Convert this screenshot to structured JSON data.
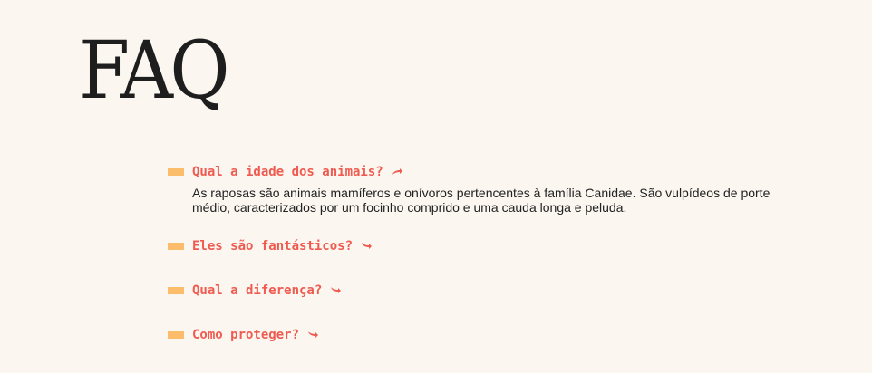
{
  "title": "FAQ",
  "colors": {
    "background": "#fbf6ef",
    "accent": "#ef5b50",
    "marker": "#fcbd6a",
    "text": "#222222"
  },
  "faq": {
    "items": [
      {
        "question": "Qual a idade dos animais?",
        "expanded": true,
        "arrow_icon": "arrow-up-curved-icon",
        "arrow_glyph": "☝",
        "answer": "As raposas são animais mamíferos e onívoros pertencentes à família Canidae. São vulpídeos de porte médio, caracterizados por um focinho comprido e uma cauda longa e peluda."
      },
      {
        "question": "Eles são fantásticos?",
        "expanded": false,
        "arrow_icon": "arrow-down-curved-icon",
        "arrow_glyph": "☟"
      },
      {
        "question": "Qual a diferença?",
        "expanded": false,
        "arrow_icon": "arrow-down-curved-icon",
        "arrow_glyph": "☟"
      },
      {
        "question": "Como proteger?",
        "expanded": false,
        "arrow_icon": "arrow-down-curved-icon",
        "arrow_glyph": "☟"
      }
    ]
  }
}
